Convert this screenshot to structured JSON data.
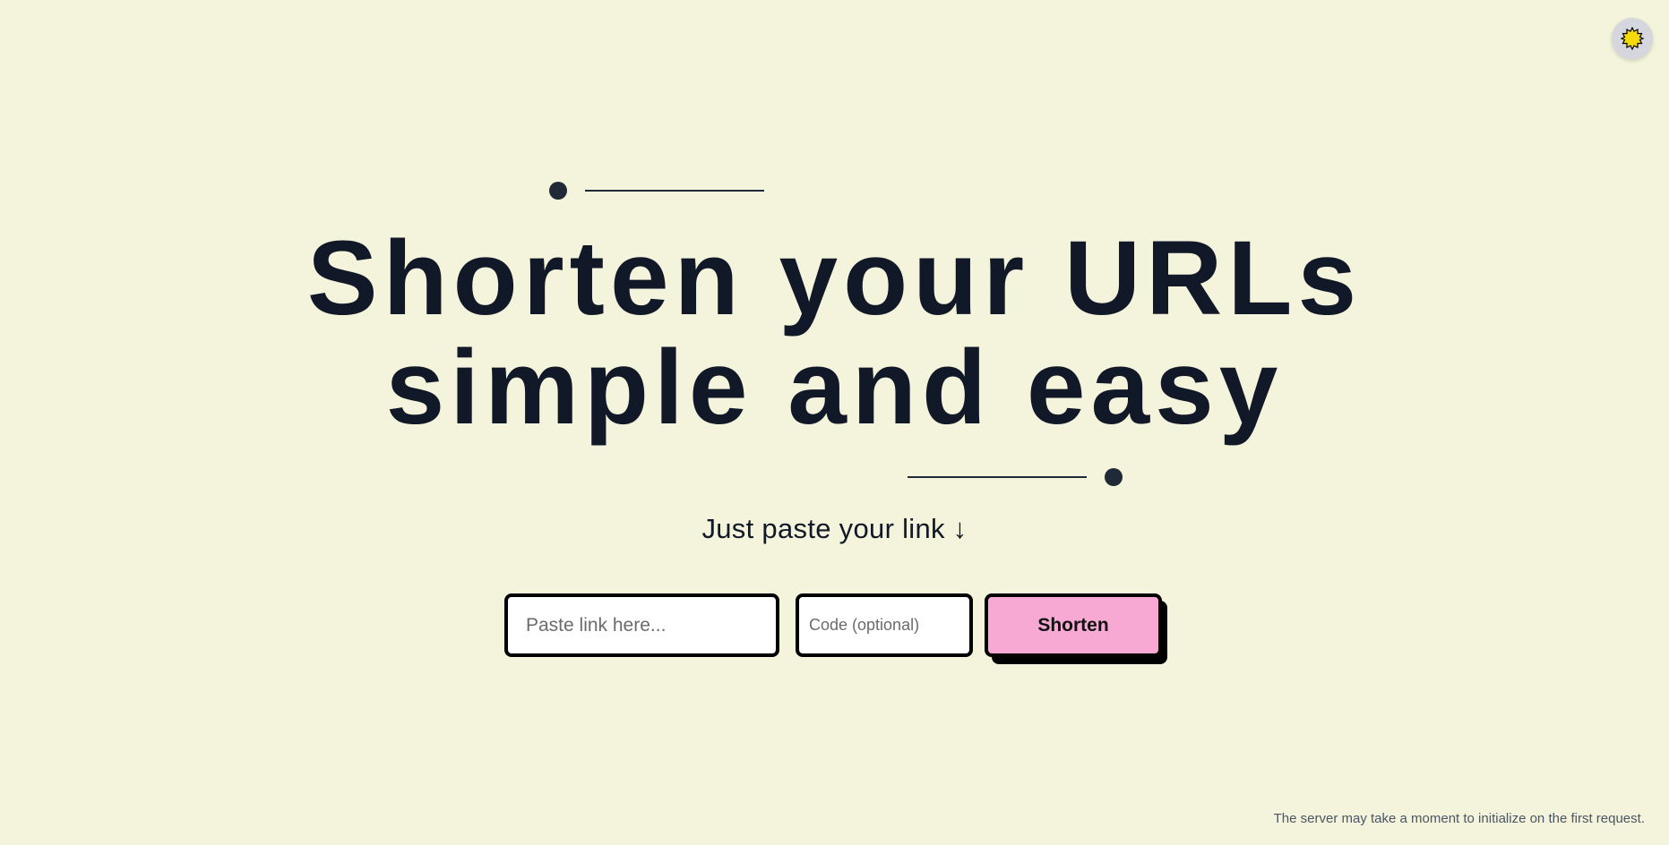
{
  "theme_toggle": {
    "icon": "sun-icon"
  },
  "hero": {
    "title_line1": "Shorten your URLs",
    "title_line2": "simple and easy",
    "subtitle": "Just paste your link ↓"
  },
  "form": {
    "link_placeholder": "Paste link here...",
    "link_value": "",
    "code_placeholder": "Code (optional)",
    "code_value": "",
    "submit_label": "Shorten"
  },
  "footer": {
    "note": "The server may take a moment to initialize on the first request."
  },
  "colors": {
    "background": "#f4f4dc",
    "text": "#111827",
    "button_accent": "#f7a8d3",
    "sun": "#f5d90a"
  }
}
